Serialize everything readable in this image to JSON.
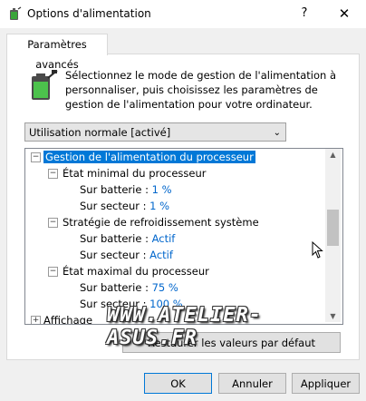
{
  "window": {
    "title": "Options d'alimentation",
    "help": "?",
    "close": "✕"
  },
  "tab": {
    "label": "Paramètres avancés"
  },
  "description": "Sélectionnez le mode de gestion de l'alimentation à personnaliser, puis choisissez les paramètres de gestion de l'alimentation pour votre ordinateur.",
  "plan_select": {
    "value": "Utilisation normale [activé]"
  },
  "tree": {
    "root": {
      "label": "Gestion de l'alimentation du processeur"
    },
    "groups": [
      {
        "label": "État minimal du processeur",
        "battery_label": "Sur batterie :",
        "battery_value": "1 %",
        "ac_label": "Sur secteur :",
        "ac_value": "1 %"
      },
      {
        "label": "Stratégie de refroidissement système",
        "battery_label": "Sur batterie :",
        "battery_value": "Actif",
        "ac_label": "Sur secteur :",
        "ac_value": "Actif"
      },
      {
        "label": "État maximal du processeur",
        "battery_label": "Sur batterie :",
        "battery_value": "75 %",
        "ac_label": "Sur secteur :",
        "ac_value": "100 %"
      }
    ],
    "partial_item": "Affichage"
  },
  "watermark": "WWW.ATELIER-ASUS.FR",
  "buttons": {
    "restore": "Restaurer les valeurs par défaut",
    "ok": "OK",
    "cancel": "Annuler",
    "apply": "Appliquer"
  }
}
